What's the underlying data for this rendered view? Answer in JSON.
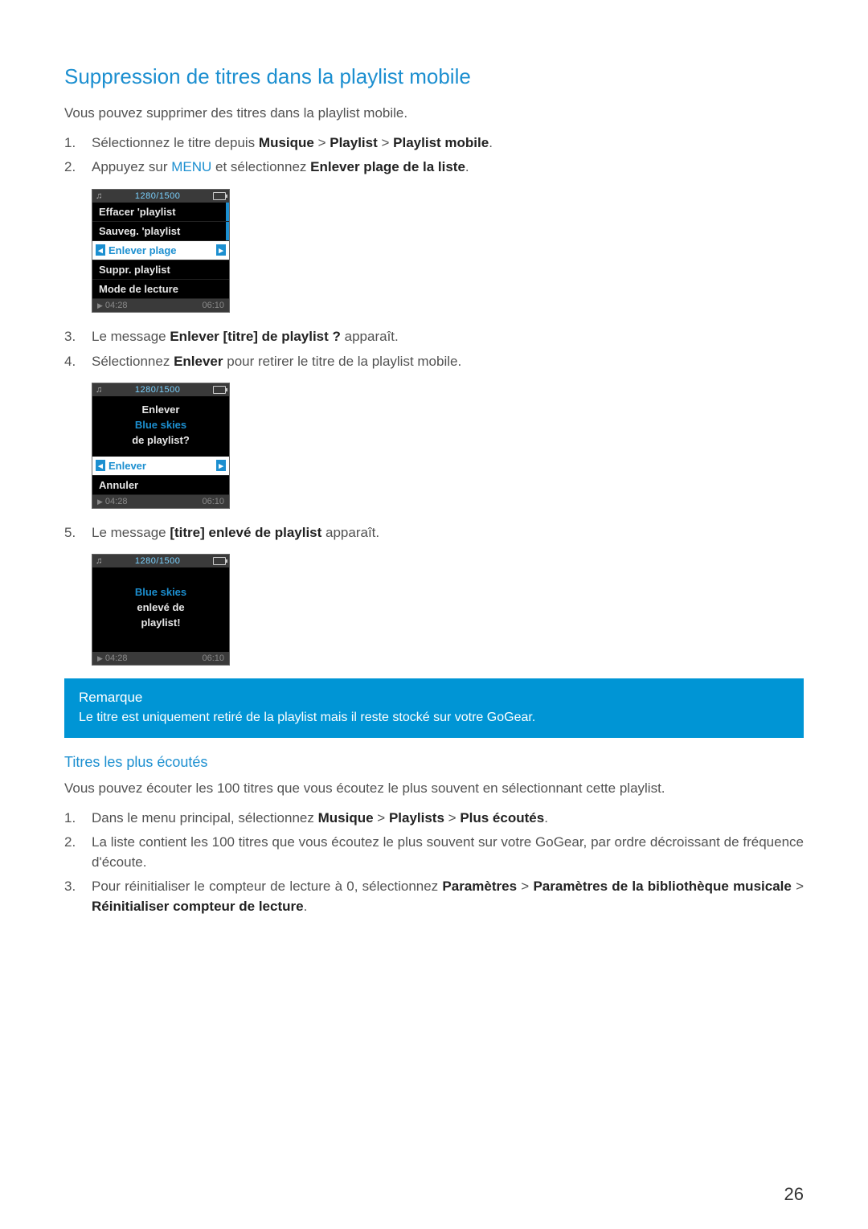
{
  "heading": "Suppression de titres dans la playlist mobile",
  "intro": "Vous pouvez supprimer des titres dans la playlist mobile.",
  "steps_a": {
    "1": {
      "pre": "Sélectionnez le titre depuis ",
      "b1": "Musique",
      "sep1": " > ",
      "b2": "Playlist",
      "sep2": " > ",
      "b3": "Playlist mobile",
      "post": "."
    },
    "2": {
      "pre": "Appuyez sur ",
      "menu": "MENU",
      "mid": " et sélectionnez ",
      "b1": "Enlever plage de la liste",
      "post": "."
    }
  },
  "device1": {
    "count": "1280/1500",
    "items": [
      "Effacer 'playlist",
      "Sauveg. 'playlist"
    ],
    "selected": "Enlever plage",
    "items2": [
      "Suppr. playlist",
      "Mode de lecture"
    ],
    "t_elapsed": "04:28",
    "t_total": "06:10"
  },
  "steps_b": {
    "3": {
      "pre": "Le message ",
      "b1": "Enlever [titre] de playlist ?",
      "post": " apparaît."
    },
    "4": {
      "pre": "Sélectionnez ",
      "b1": "Enlever",
      "post": " pour retirer le titre de la playlist mobile."
    }
  },
  "device2": {
    "count": "1280/1500",
    "msg_l1": "Enlever",
    "msg_track": "Blue skies",
    "msg_l3": "de playlist?",
    "selected": "Enlever",
    "items": [
      "Annuler"
    ],
    "t_elapsed": "04:28",
    "t_total": "06:10"
  },
  "steps_c": {
    "5": {
      "pre": "Le message ",
      "b1": "[titre] enlevé de playlist",
      "post": " apparaît."
    }
  },
  "device3": {
    "count": "1280/1500",
    "msg_track": "Blue skies",
    "msg_l2": "enlevé de",
    "msg_l3": "playlist!",
    "t_elapsed": "04:28",
    "t_total": "06:10"
  },
  "note": {
    "title": "Remarque",
    "body": "Le titre est uniquement retiré de la playlist mais il reste stocké sur votre GoGear."
  },
  "sub": {
    "heading": "Titres les plus écoutés",
    "intro": "Vous pouvez écouter les 100 titres que vous écoutez le plus souvent en sélectionnant cette playlist.",
    "steps": {
      "1": {
        "pre": "Dans le menu principal, sélectionnez ",
        "b1": "Musique",
        "sep1": " > ",
        "b2": "Playlists",
        "sep2": " > ",
        "b3": "Plus écoutés",
        "post": "."
      },
      "2": {
        "text": "La liste contient les 100 titres que vous écoutez le plus souvent sur votre GoGear, par ordre décroissant de fréquence d'écoute."
      },
      "3": {
        "pre": "Pour réinitialiser le compteur de lecture à 0, sélectionnez ",
        "b1": "Paramètres",
        "sep1": " > ",
        "b2": "Paramètres de la bibliothèque musicale",
        "sep2": " > ",
        "b3": "Réinitialiser compteur de lecture",
        "post": "."
      }
    }
  },
  "page_number": "26"
}
